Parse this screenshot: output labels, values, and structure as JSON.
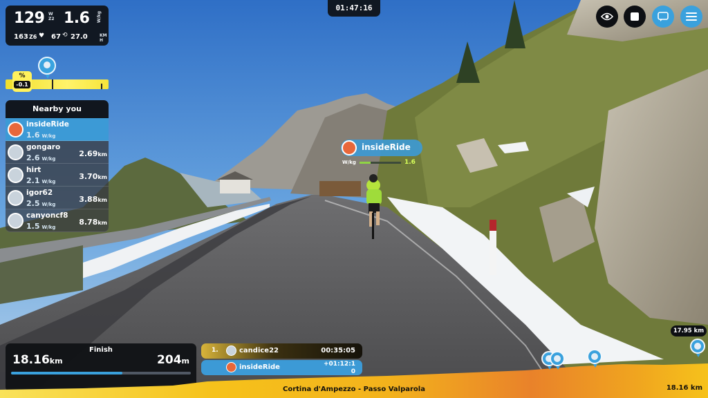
{
  "stats": {
    "power": "129",
    "power_unit_top": "W",
    "zone": "Z2",
    "wkg": "1.6",
    "wkg_unit": "W/kg",
    "heart_rate": "163",
    "hr_zone": "Z6",
    "cadence": "67",
    "speed": "27.0",
    "speed_unit_top": "KM",
    "speed_unit_bottom": "H"
  },
  "grade": {
    "label": "%",
    "value": "-0.1"
  },
  "nearby": {
    "title": "Nearby you",
    "wkg_unit": "W/kg",
    "dist_unit": "km",
    "riders": [
      {
        "name": "insideRide",
        "wkg": "1.6",
        "distance": "",
        "is_me": true
      },
      {
        "name": "gongaro",
        "wkg": "2.6",
        "distance": "2.69"
      },
      {
        "name": "hirt",
        "wkg": "2.1",
        "distance": "3.70"
      },
      {
        "name": "igor62",
        "wkg": "2.5",
        "distance": "3.88"
      },
      {
        "name": "canyoncf8",
        "wkg": "1.5",
        "distance": "8.78"
      }
    ]
  },
  "timer": "01:47:16",
  "rider_label": {
    "name": "insideRide",
    "wkg_label": "W/kg",
    "wkg_value": "1.6",
    "wkg_fraction": 0.26
  },
  "distance_panel": {
    "label": "Finish",
    "current": "18.16",
    "current_unit": "km",
    "total": "204",
    "total_unit": "m",
    "progress": 0.62
  },
  "leaderboard": [
    {
      "rank": "1.",
      "name": "candice22",
      "time": "00:35:05"
    },
    {
      "rank": "",
      "name": "insideRide",
      "gap_line1": "+01:12:1",
      "gap_line2": "0"
    }
  ],
  "route": {
    "name": "Cortina d'Ampezzo - Passo Valparola",
    "total_distance": "18.16 km",
    "marker_distance": "17.95 km"
  },
  "top_buttons": [
    {
      "icon": "eye-icon"
    },
    {
      "icon": "stop-icon"
    },
    {
      "icon": "chat-icon"
    },
    {
      "icon": "menu-icon"
    }
  ],
  "colors": {
    "accent": "#3aa1dd",
    "panel": "#0e1014",
    "elevation_yellow": "#f6c21b",
    "elevation_orange": "#e9822a"
  }
}
